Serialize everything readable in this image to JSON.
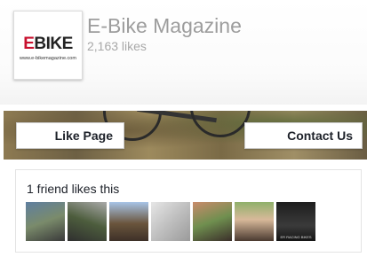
{
  "page": {
    "logo": {
      "word_e": "E",
      "word_rest": "BIKE",
      "url": "www.e-bikemagazine.com"
    },
    "name": "E-Bike Magazine",
    "likes": "2,163 likes"
  },
  "actions": {
    "like_label": "Like Page",
    "contact_label": "Contact Us"
  },
  "friends": {
    "title": "1 friend likes this",
    "avatars": [
      "friend-photo-1",
      "friend-photo-2",
      "friend-photo-3",
      "friend-photo-4",
      "friend-photo-5",
      "friend-photo-6",
      "friend-photo-7"
    ],
    "last_avatar_caption": "ER RACING BIKES"
  }
}
